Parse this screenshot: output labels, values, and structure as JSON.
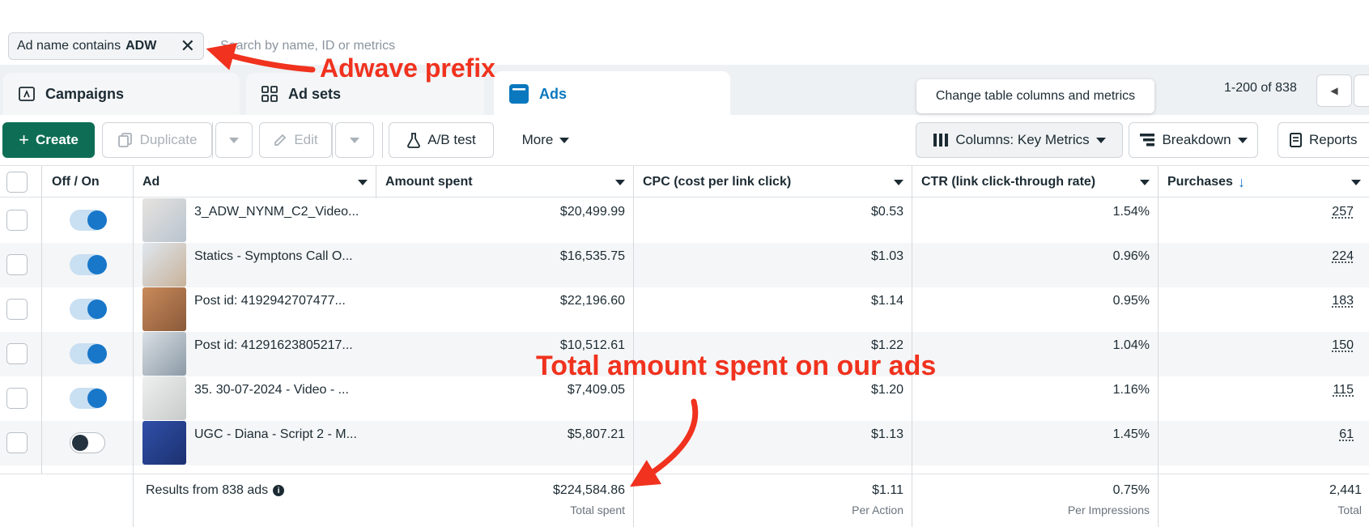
{
  "filter": {
    "chip_prefix": "Ad name contains",
    "chip_value": "ADW",
    "search_placeholder": "Search by name, ID or metrics"
  },
  "tabs": [
    {
      "label": "Campaigns",
      "icon": "campaign-icon"
    },
    {
      "label": "Ad sets",
      "icon": "grid-icon"
    },
    {
      "label": "Ads",
      "icon": "ad-icon",
      "active": true
    }
  ],
  "tooltip": "Change table columns and metrics",
  "pagination": {
    "range": "1-200 of 838"
  },
  "toolbar": {
    "create": "Create",
    "duplicate": "Duplicate",
    "edit": "Edit",
    "ab_test": "A/B test",
    "more": "More",
    "columns": "Columns: Key Metrics",
    "breakdown": "Breakdown",
    "reports": "Reports"
  },
  "table": {
    "headers": {
      "toggle": "Off / On",
      "ad": "Ad",
      "spent": "Amount spent",
      "cpc": "CPC (cost per link click)",
      "ctr": "CTR (link click-through rate)",
      "purchases": "Purchases"
    },
    "rows": [
      {
        "on": true,
        "ad": "3_ADW_NYNM_C2_Video...",
        "spent": "$20,499.99",
        "cpc": "$0.53",
        "ctr": "1.54%",
        "purchases": "257"
      },
      {
        "on": true,
        "ad": "Statics - Symptons Call O...",
        "spent": "$16,535.75",
        "cpc": "$1.03",
        "ctr": "0.96%",
        "purchases": "224"
      },
      {
        "on": true,
        "ad": "Post id: 4192942707477...",
        "spent": "$22,196.60",
        "cpc": "$1.14",
        "ctr": "0.95%",
        "purchases": "183"
      },
      {
        "on": true,
        "ad": "Post id: 41291623805217...",
        "spent": "$10,512.61",
        "cpc": "$1.22",
        "ctr": "1.04%",
        "purchases": "150"
      },
      {
        "on": true,
        "ad": "35. 30-07-2024 - Video - ...",
        "spent": "$7,409.05",
        "cpc": "$1.20",
        "ctr": "1.16%",
        "purchases": "115"
      },
      {
        "on": false,
        "ad": "UGC - Diana - Script 2 - M...",
        "spent": "$5,807.21",
        "cpc": "$1.13",
        "ctr": "1.45%",
        "purchases": "61"
      }
    ],
    "summary": {
      "label": "Results from 838 ads",
      "spent": "$224,584.86",
      "spent_sub": "Total spent",
      "cpc": "$1.11",
      "cpc_sub": "Per Action",
      "ctr": "0.75%",
      "ctr_sub": "Per Impressions",
      "purchases": "2,441",
      "purchases_sub": "Total"
    }
  },
  "annotations": {
    "prefix_note": "Adwave prefix",
    "total_note": "Total amount spent on our ads",
    "color": "#f0321e"
  }
}
